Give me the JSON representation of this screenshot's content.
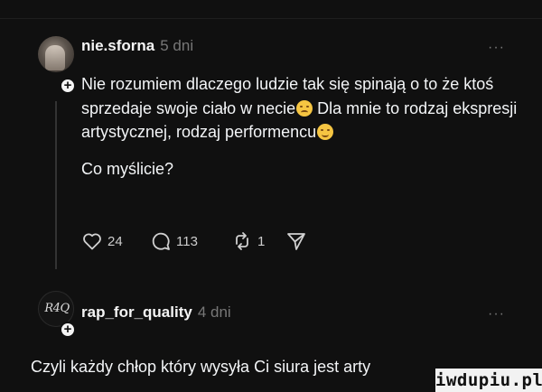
{
  "post": {
    "username": "nie.sforna",
    "time": "5 dni",
    "more": "···",
    "paragraph1_a": "Nie rozumiem dlaczego ludzie tak się spinają o to że ktoś sprzedaje swoje ciało w necie",
    "emoji1": "pensive-face-emoji",
    "paragraph1_b": " Dla mnie to rodzaj ekspresji artystycznej, rodzaj performencu",
    "emoji2": "smiling-face-emoji",
    "paragraph2": "Co myślicie?",
    "likes": "24",
    "comments": "113",
    "reposts": "1"
  },
  "reply": {
    "username": "rap_for_quality",
    "time": "4 dni",
    "more": "···",
    "avatar_logo": "R4Q",
    "text": "Czyli każdy chłop który wysyła Ci siura jest arty"
  },
  "watermark": "iwdupiu.pl",
  "colors": {
    "background": "#101010",
    "text": "#f3f5f7",
    "muted": "#777777"
  }
}
